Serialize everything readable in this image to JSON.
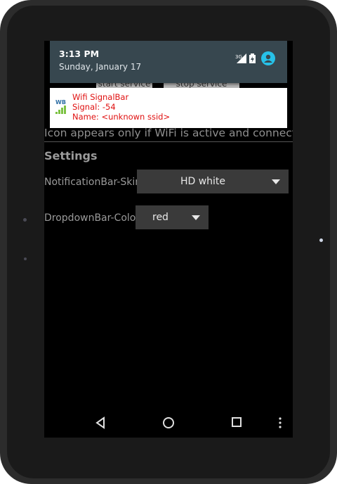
{
  "status": {
    "time": "3:13 PM",
    "date": "Sunday, January 17",
    "network": "3G"
  },
  "notification": {
    "app_name": "Wifi SignalBar",
    "signal_line": "Signal: -54",
    "name_line": "Name: <unknown ssid>",
    "icon_text": "WB"
  },
  "app": {
    "start_button": "start service",
    "stop_button": "stop service",
    "info_text": "Icon appears only if WiFi is active and connected.",
    "settings_title": "Settings",
    "skin_label": "NotificationBar-Skin:",
    "skin_value": "HD white",
    "color_label": "DropdownBar-Color:",
    "color_value": "red"
  },
  "colors": {
    "notification_text": "#e01010",
    "shade_bg": "#37474f",
    "avatar": "#27c1e8"
  },
  "nav": {
    "back_icon": "back-icon",
    "home_icon": "home-icon",
    "recents_icon": "recents-icon",
    "menu_icon": "overflow-menu-icon"
  }
}
